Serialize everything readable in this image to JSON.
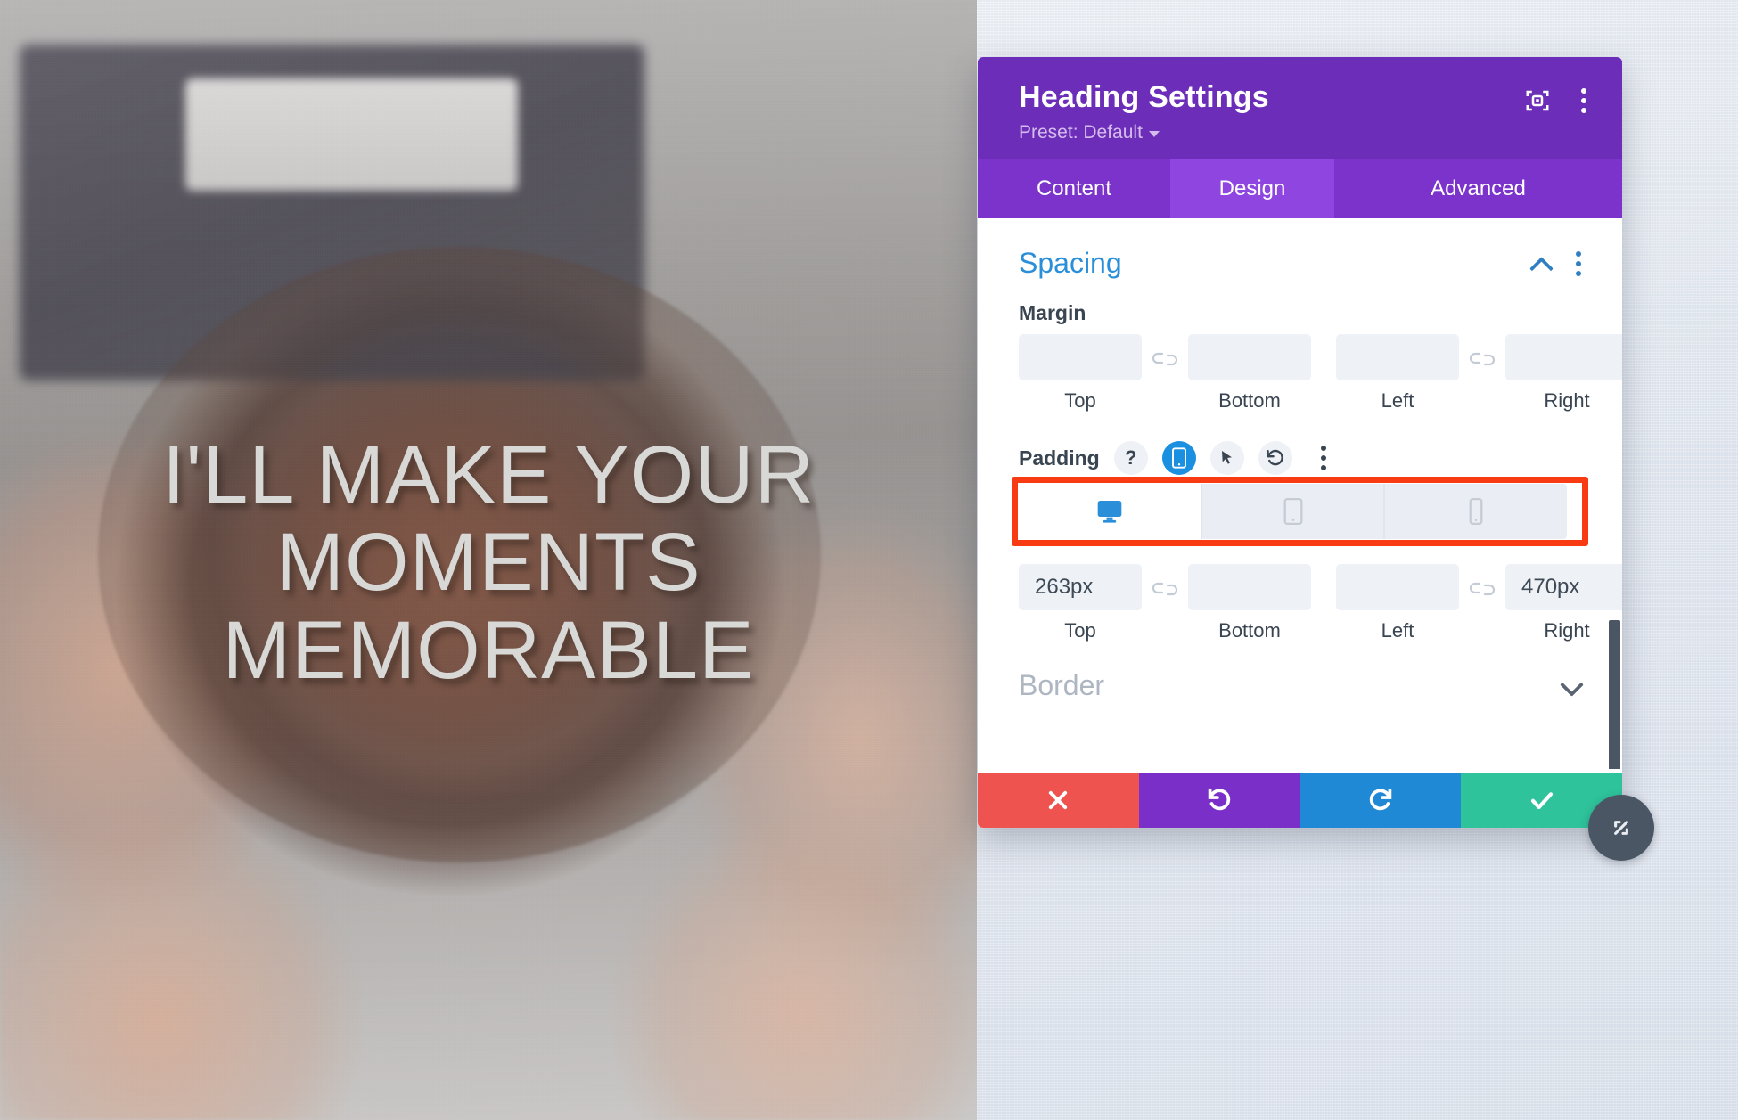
{
  "hero": {
    "headline": "I'LL MAKE YOUR\nMOMENTS\nMEMORABLE",
    "text_color": "#d8d8d6"
  },
  "modal": {
    "title": "Heading Settings",
    "preset_label": "Preset: Default",
    "header_color": "#6c2eb9",
    "icons": {
      "focus": "focus-target-icon",
      "menu": "kebab-menu-icon"
    },
    "tabs": [
      {
        "label": "Content",
        "active": false
      },
      {
        "label": "Design",
        "active": true
      },
      {
        "label": "Advanced",
        "active": false
      }
    ],
    "active_tab_color": "#8f45e0",
    "section": {
      "title": "Spacing",
      "title_color": "#2a8fd8",
      "collapse_icon": "chevron-up-icon",
      "menu_icon": "kebab-menu-icon"
    },
    "margin": {
      "label": "Margin",
      "link_icon": "broken-link-icon",
      "fields": [
        {
          "label": "Top",
          "value": "",
          "placeholder": ""
        },
        {
          "label": "Bottom",
          "value": "",
          "placeholder": ""
        },
        {
          "label": "Left",
          "value": "",
          "placeholder": ""
        },
        {
          "label": "Right",
          "value": "",
          "placeholder": ""
        }
      ]
    },
    "padding": {
      "label": "Padding",
      "link_icon": "broken-link-icon",
      "controls": [
        {
          "name": "help-icon",
          "glyph": "?",
          "active": false
        },
        {
          "name": "responsive-icon",
          "glyph": "",
          "active": true
        },
        {
          "name": "hover-cursor-icon",
          "glyph": "",
          "active": false
        },
        {
          "name": "reset-icon",
          "glyph": "",
          "active": false
        },
        {
          "name": "kebab-menu-icon",
          "glyph": "",
          "active": false
        }
      ],
      "devices": [
        {
          "name": "desktop",
          "active": true
        },
        {
          "name": "tablet",
          "active": false
        },
        {
          "name": "phone",
          "active": false
        }
      ],
      "highlight_color": "#f83b12",
      "fields": [
        {
          "label": "Top",
          "value": "263px",
          "placeholder": ""
        },
        {
          "label": "Bottom",
          "value": "",
          "placeholder": ""
        },
        {
          "label": "Left",
          "value": "",
          "placeholder": ""
        },
        {
          "label": "Right",
          "value": "470px",
          "placeholder": ""
        }
      ]
    },
    "border": {
      "title": "Border",
      "expand_icon": "chevron-down-icon"
    },
    "actions": [
      {
        "name": "cancel",
        "icon": "close-x-icon",
        "color": "#ef5350"
      },
      {
        "name": "undo",
        "icon": "undo-arrow-icon",
        "color": "#7b2fc9"
      },
      {
        "name": "redo",
        "icon": "redo-arrow-icon",
        "color": "#2089d6"
      },
      {
        "name": "save",
        "icon": "checkmark-icon",
        "color": "#2ec39b"
      }
    ],
    "resize_handle_icon": "diagonal-resize-icon"
  }
}
